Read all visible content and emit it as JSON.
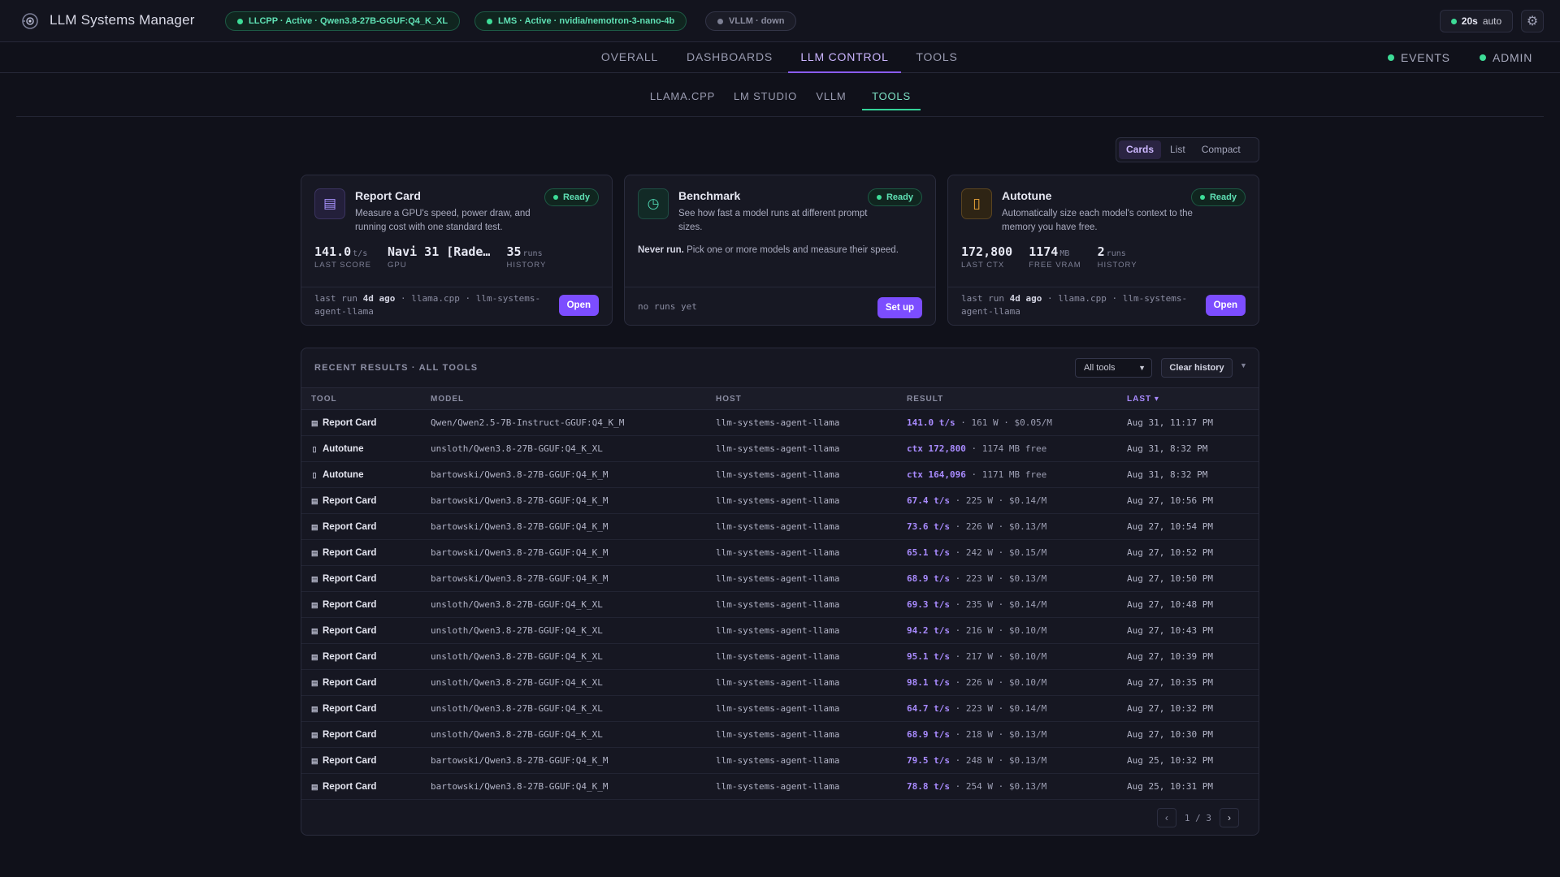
{
  "app": {
    "title": "LLM Systems Manager",
    "status_pills": [
      {
        "label": "LLCPP · Active · Qwen3.8-27B-GGUF:Q4_K_XL",
        "state": "active"
      },
      {
        "label": "LMS · Active · nvidia/nemotron-3-nano-4b",
        "state": "active"
      },
      {
        "label": "VLLM · down",
        "state": "down"
      }
    ],
    "refresh": {
      "interval": "20s",
      "mode": "auto"
    },
    "settings_icon": "gear-icon"
  },
  "nav": {
    "tabs": [
      {
        "label": "OVERALL"
      },
      {
        "label": "DASHBOARDS"
      },
      {
        "label": "LLM CONTROL",
        "active": true
      },
      {
        "label": "TOOLS"
      }
    ],
    "right": [
      {
        "label": "EVENTS"
      },
      {
        "label": "ADMIN"
      }
    ]
  },
  "subnav": {
    "tabs": [
      {
        "label": "LLAMA.CPP"
      },
      {
        "label": "LM STUDIO"
      },
      {
        "label": "VLLM"
      },
      {
        "label": "TOOLS",
        "active": true
      }
    ]
  },
  "view_toggle": {
    "options": [
      "Cards",
      "List",
      "Compact"
    ],
    "selected": "Cards"
  },
  "cards": [
    {
      "title": "Report Card",
      "icon": "list-icon",
      "status": "Ready",
      "description": "Measure a GPU's speed, power draw, and running cost with one standard test.",
      "stats": [
        {
          "value": "141.0",
          "unit": "t/s",
          "label": "LAST SCORE"
        },
        {
          "value": "Navi 31 [Rade…",
          "unit": "",
          "label": "GPU"
        },
        {
          "value": "35",
          "unit": "runs",
          "label": "HISTORY"
        }
      ],
      "footer": {
        "prefix": "last run ",
        "age": "4d ago",
        "suffix": " · llama.cpp · llm-systems-agent-llama"
      },
      "button": "Open"
    },
    {
      "title": "Benchmark",
      "icon": "clock-icon",
      "status": "Ready",
      "description": "See how fast a model runs at different prompt sizes.",
      "empty_strong": "Never run.",
      "empty_text": " Pick one or more models and measure their speed.",
      "footer_text": "no runs yet",
      "button": "Set up"
    },
    {
      "title": "Autotune",
      "icon": "tune-icon",
      "status": "Ready",
      "description": "Automatically size each model's context to the memory you have free.",
      "stats": [
        {
          "value": "172,800",
          "unit": "",
          "label": "LAST CTX"
        },
        {
          "value": "1174",
          "unit": "MB",
          "label": "FREE VRAM"
        },
        {
          "value": "2",
          "unit": "runs",
          "label": "HISTORY"
        }
      ],
      "footer": {
        "prefix": "last run ",
        "age": "4d ago",
        "suffix": " · llama.cpp · llm-systems-agent-llama"
      },
      "button": "Open"
    }
  ],
  "results": {
    "title": "RECENT RESULTS · ALL TOOLS",
    "filter": "All tools",
    "clear": "Clear history",
    "columns": [
      "TOOL",
      "MODEL",
      "HOST",
      "RESULT",
      "LAST ▾"
    ],
    "rows": [
      {
        "tool": "Report Card",
        "kind": "rc",
        "model": "Qwen/Qwen2.5-7B-Instruct-GGUF:Q4_K_M",
        "host": "llm-systems-agent-llama",
        "lead": "141.0 t/s",
        "rest": " · 161 W · $0.05/M",
        "last": "Aug 31, 11:17 PM"
      },
      {
        "tool": "Autotune",
        "kind": "at",
        "model": "unsloth/Qwen3.8-27B-GGUF:Q4_K_XL",
        "host": "llm-systems-agent-llama",
        "lead": "ctx 172,800",
        "rest": " · 1174 MB free",
        "last": "Aug 31, 8:32 PM"
      },
      {
        "tool": "Autotune",
        "kind": "at",
        "model": "bartowski/Qwen3.8-27B-GGUF:Q4_K_M",
        "host": "llm-systems-agent-llama",
        "lead": "ctx 164,096",
        "rest": " · 1171 MB free",
        "last": "Aug 31, 8:32 PM"
      },
      {
        "tool": "Report Card",
        "kind": "rc",
        "model": "bartowski/Qwen3.8-27B-GGUF:Q4_K_M",
        "host": "llm-systems-agent-llama",
        "lead": "67.4 t/s",
        "rest": " · 225 W · $0.14/M",
        "last": "Aug 27, 10:56 PM"
      },
      {
        "tool": "Report Card",
        "kind": "rc",
        "model": "bartowski/Qwen3.8-27B-GGUF:Q4_K_M",
        "host": "llm-systems-agent-llama",
        "lead": "73.6 t/s",
        "rest": " · 226 W · $0.13/M",
        "last": "Aug 27, 10:54 PM"
      },
      {
        "tool": "Report Card",
        "kind": "rc",
        "model": "bartowski/Qwen3.8-27B-GGUF:Q4_K_M",
        "host": "llm-systems-agent-llama",
        "lead": "65.1 t/s",
        "rest": " · 242 W · $0.15/M",
        "last": "Aug 27, 10:52 PM"
      },
      {
        "tool": "Report Card",
        "kind": "rc",
        "model": "bartowski/Qwen3.8-27B-GGUF:Q4_K_M",
        "host": "llm-systems-agent-llama",
        "lead": "68.9 t/s",
        "rest": " · 223 W · $0.13/M",
        "last": "Aug 27, 10:50 PM"
      },
      {
        "tool": "Report Card",
        "kind": "rc",
        "model": "unsloth/Qwen3.8-27B-GGUF:Q4_K_XL",
        "host": "llm-systems-agent-llama",
        "lead": "69.3 t/s",
        "rest": " · 235 W · $0.14/M",
        "last": "Aug 27, 10:48 PM"
      },
      {
        "tool": "Report Card",
        "kind": "rc",
        "model": "unsloth/Qwen3.8-27B-GGUF:Q4_K_XL",
        "host": "llm-systems-agent-llama",
        "lead": "94.2 t/s",
        "rest": " · 216 W · $0.10/M",
        "last": "Aug 27, 10:43 PM"
      },
      {
        "tool": "Report Card",
        "kind": "rc",
        "model": "unsloth/Qwen3.8-27B-GGUF:Q4_K_XL",
        "host": "llm-systems-agent-llama",
        "lead": "95.1 t/s",
        "rest": " · 217 W · $0.10/M",
        "last": "Aug 27, 10:39 PM"
      },
      {
        "tool": "Report Card",
        "kind": "rc",
        "model": "unsloth/Qwen3.8-27B-GGUF:Q4_K_XL",
        "host": "llm-systems-agent-llama",
        "lead": "98.1 t/s",
        "rest": " · 226 W · $0.10/M",
        "last": "Aug 27, 10:35 PM"
      },
      {
        "tool": "Report Card",
        "kind": "rc",
        "model": "unsloth/Qwen3.8-27B-GGUF:Q4_K_XL",
        "host": "llm-systems-agent-llama",
        "lead": "64.7 t/s",
        "rest": " · 223 W · $0.14/M",
        "last": "Aug 27, 10:32 PM"
      },
      {
        "tool": "Report Card",
        "kind": "rc",
        "model": "unsloth/Qwen3.8-27B-GGUF:Q4_K_XL",
        "host": "llm-systems-agent-llama",
        "lead": "68.9 t/s",
        "rest": " · 218 W · $0.13/M",
        "last": "Aug 27, 10:30 PM"
      },
      {
        "tool": "Report Card",
        "kind": "rc",
        "model": "bartowski/Qwen3.8-27B-GGUF:Q4_K_M",
        "host": "llm-systems-agent-llama",
        "lead": "79.5 t/s",
        "rest": " · 248 W · $0.13/M",
        "last": "Aug 25, 10:32 PM"
      },
      {
        "tool": "Report Card",
        "kind": "rc",
        "model": "bartowski/Qwen3.8-27B-GGUF:Q4_K_M",
        "host": "llm-systems-agent-llama",
        "lead": "78.8 t/s",
        "rest": " · 254 W · $0.13/M",
        "last": "Aug 25, 10:31 PM"
      }
    ],
    "pagination": {
      "prev": "‹",
      "page": "1 / 3",
      "next": "›"
    }
  },
  "colors": {
    "accent": "#8b5cf6",
    "active_green": "#3ddc97",
    "background": "#10111a"
  }
}
